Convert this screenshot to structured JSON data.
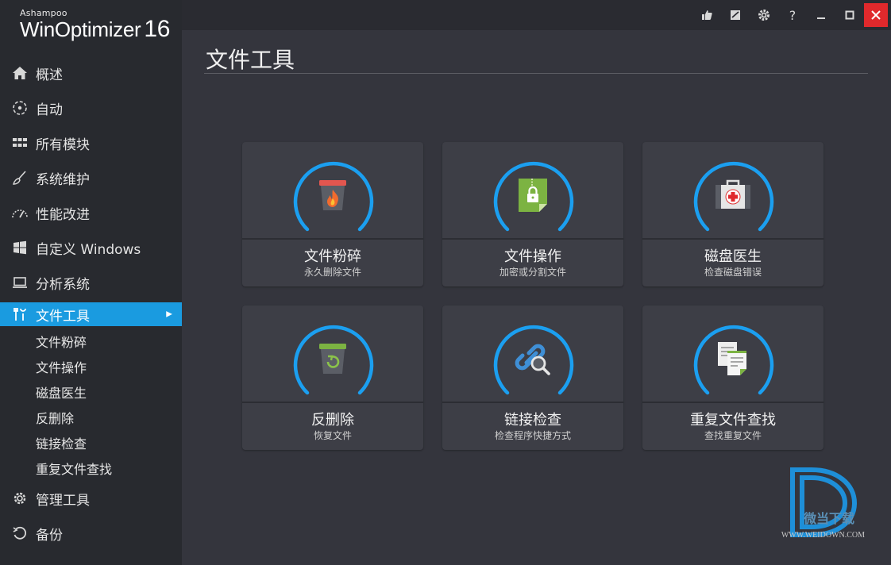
{
  "brand": {
    "company": "Ashampoo",
    "product": "WinOptimizer",
    "version": "16"
  },
  "sidebar": {
    "items": [
      {
        "label": "概述",
        "icon": "home-icon"
      },
      {
        "label": "自动",
        "icon": "auto-icon"
      },
      {
        "label": "所有模块",
        "icon": "grid-icon"
      },
      {
        "label": "系统维护",
        "icon": "broom-icon"
      },
      {
        "label": "性能改进",
        "icon": "gauge-icon"
      },
      {
        "label": "自定义 Windows",
        "icon": "windows-icon"
      },
      {
        "label": "分析系统",
        "icon": "laptop-icon"
      },
      {
        "label": "文件工具",
        "icon": "tools-icon",
        "active": true
      }
    ],
    "subitems": [
      "文件粉碎",
      "文件操作",
      "磁盘医生",
      "反删除",
      "链接检查",
      "重复文件查找"
    ],
    "bottom_items": [
      {
        "label": "管理工具",
        "icon": "gear-icon"
      },
      {
        "label": "备份",
        "icon": "restore-icon"
      }
    ]
  },
  "titlebar": {
    "buttons": [
      "thumbs-up-icon",
      "notes-icon",
      "settings-icon",
      "help-icon",
      "minimize-icon",
      "maximize-icon",
      "close-icon"
    ],
    "help": "?"
  },
  "main": {
    "title": "文件工具",
    "tiles": [
      {
        "name": "文件粉碎",
        "desc": "永久删除文件",
        "icon": "shredder-bin-icon"
      },
      {
        "name": "文件操作",
        "desc": "加密或分割文件",
        "icon": "locked-file-icon"
      },
      {
        "name": "磁盘医生",
        "desc": "检查磁盘错误",
        "icon": "medical-kit-icon"
      },
      {
        "name": "反删除",
        "desc": "恢复文件",
        "icon": "restore-bin-icon"
      },
      {
        "name": "链接检查",
        "desc": "检查程序快捷方式",
        "icon": "link-search-icon"
      },
      {
        "name": "重复文件查找",
        "desc": "查找重复文件",
        "icon": "duplicate-files-icon"
      }
    ]
  },
  "watermark": {
    "text": "微当下载",
    "url": "WWW.WEIDOWN.COM"
  },
  "colors": {
    "accent": "#1a9be0",
    "sidebar_bg": "#282a2f",
    "main_bg": "#34353d",
    "tile_bg": "#3d3e46",
    "close_red": "#e0292c"
  }
}
